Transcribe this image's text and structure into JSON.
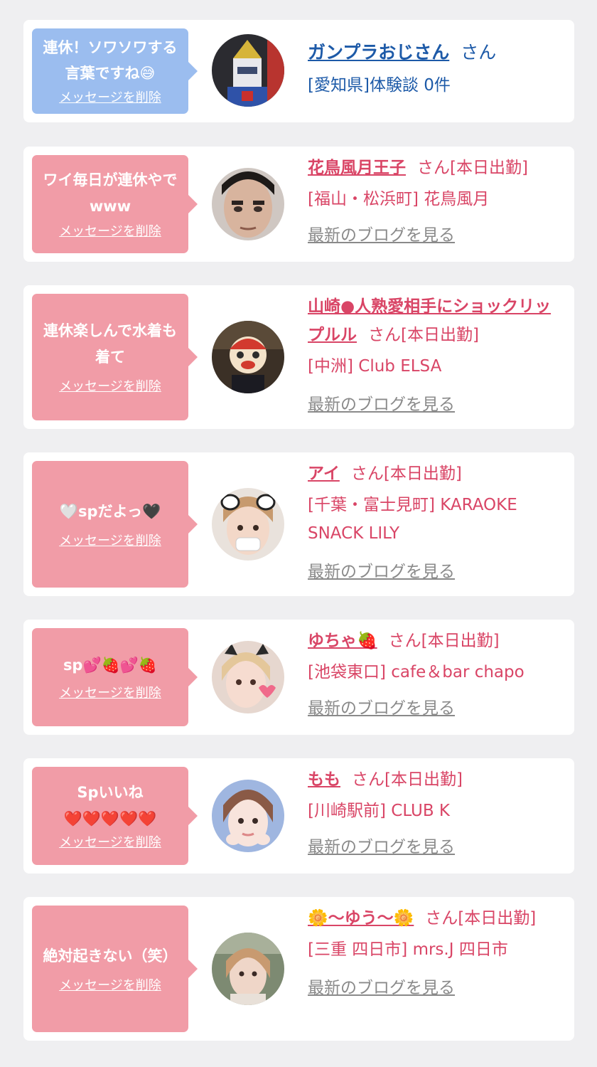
{
  "delete_label": "メッセージを削除",
  "blog_label": "最新のブログを見る",
  "colors": {
    "pink_bubble": "#f19ca7",
    "blue_bubble": "#9bbdef",
    "name_red": "#d94566",
    "name_blue": "#1d5aa8",
    "link_gray": "#8a8a8a",
    "background": "#efeff1"
  },
  "items": [
    {
      "message": "連休！ソワソワする言葉ですね😅",
      "name": "ガンプラおじさん",
      "suffix": "さん",
      "location": "[愛知県]体験談 0件"
    },
    {
      "message": "ワイ毎日が連休やでwww",
      "name": "花鳥風月王子",
      "suffix": "さん[本日出勤]",
      "location": "[福山・松浜町] 花鳥風月"
    },
    {
      "message": "連休楽しんで水着も着て",
      "name": "山崎●人熟愛相手にショックリップルル",
      "suffix": "さん[本日出勤]",
      "location": "[中洲] Club ELSA"
    },
    {
      "message": "🤍spだよっ🖤",
      "name": "アイ",
      "suffix": "さん[本日出勤]",
      "location": "[千葉・富士見町] KARAOKE SNACK LILY"
    },
    {
      "message": "sp💕🍓💕🍓",
      "name": "ゆちゃ🍓",
      "suffix": "さん[本日出勤]",
      "location": "[池袋東口] cafe＆bar chapo"
    },
    {
      "message": "Spいいね\n❤️❤️❤️❤️❤️",
      "name": "もも",
      "suffix": "さん[本日出勤]",
      "location": "[川崎駅前] CLUB K"
    },
    {
      "message": "絶対起きない（笑）",
      "name": "🌼〜ゆう〜🌼",
      "suffix": "さん[本日出勤]",
      "location": "[三重 四日市] mrs.J 四日市"
    }
  ]
}
